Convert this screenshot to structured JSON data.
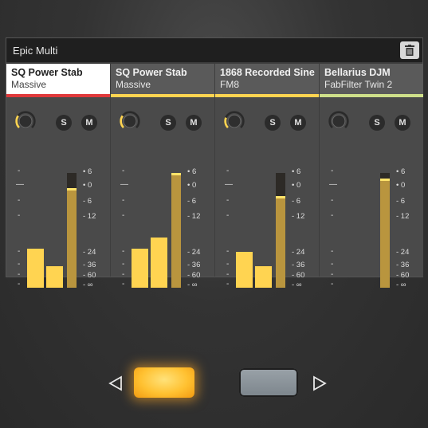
{
  "header": {
    "title": "Epic Multi",
    "delete_icon": "trash-icon"
  },
  "channels": [
    {
      "line1": "SQ Power Stab",
      "line2": "Massive",
      "selected": true,
      "accent": "#e0393b",
      "solo": "S",
      "mute": "M",
      "knob_level": 0.3,
      "bar1_level": 0.55,
      "bar2_level": 0.3,
      "meter_level": 0.87
    },
    {
      "line1": "SQ Power Stab",
      "line2": "Massive",
      "selected": false,
      "accent": "#ffd451",
      "solo": "S",
      "mute": "M",
      "knob_level": 0.3,
      "bar1_level": 0.55,
      "bar2_level": 0.7,
      "meter_level": 1.0
    },
    {
      "line1": "1868 Recorded Sine",
      "line2": "FM8",
      "selected": false,
      "accent": "#ffd451",
      "solo": "S",
      "mute": "M",
      "knob_level": 0.25,
      "bar1_level": 0.5,
      "bar2_level": 0.3,
      "meter_level": 0.8
    },
    {
      "line1": "Bellarius DJM",
      "line2": "FabFilter Twin 2",
      "selected": false,
      "accent": "#cfe08a",
      "solo": "S",
      "mute": "M",
      "knob_level": 0.0,
      "bar1_level": 0.0,
      "bar2_level": 0.0,
      "meter_level": 0.95
    }
  ],
  "right_scale": [
    "6",
    "0",
    "- 6",
    "- 12",
    "- 24",
    "- 36",
    "- 60",
    "- ∞"
  ],
  "left_scale_marks": [
    "-",
    "—",
    "-",
    "-",
    "-",
    "-",
    "-",
    "-"
  ],
  "footer": {
    "prev_icon": "triangle-left-icon",
    "next_icon": "triangle-right-icon",
    "colors": {
      "active": "#ffc131",
      "inactive": "#8a9298"
    }
  }
}
